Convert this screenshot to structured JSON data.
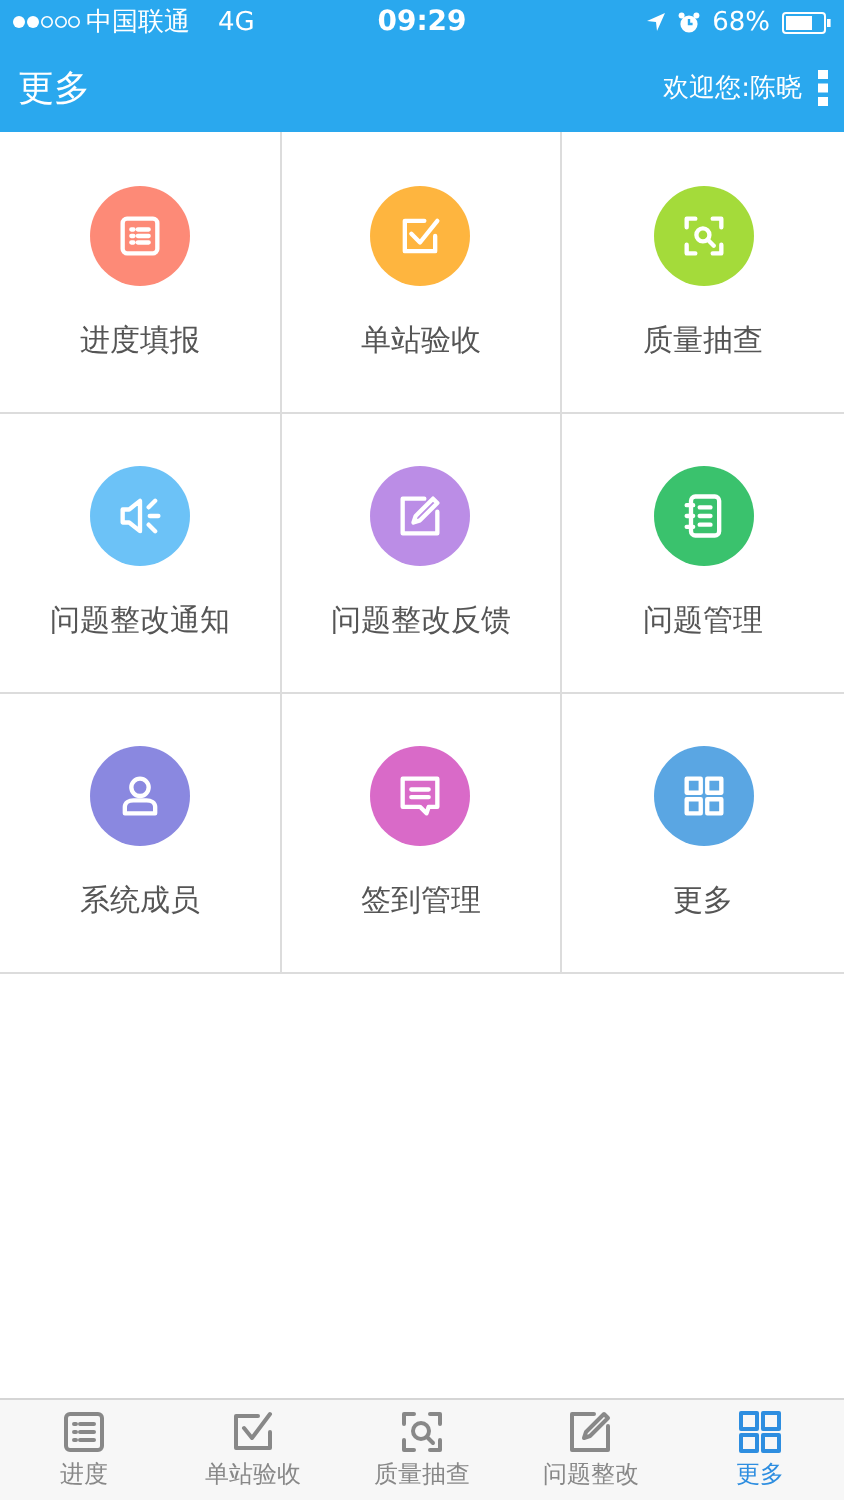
{
  "status_bar": {
    "carrier": "中国联通",
    "network": "4G",
    "time": "09:29",
    "battery": "68%"
  },
  "header": {
    "title": "更多",
    "welcome": "欢迎您:陈晓"
  },
  "grid": [
    {
      "label": "进度填报",
      "kind": "list",
      "color": "#fd8a77"
    },
    {
      "label": "单站验收",
      "kind": "check",
      "color": "#feb53f"
    },
    {
      "label": "质量抽查",
      "kind": "scan",
      "color": "#a4db3a"
    },
    {
      "label": "问题整改通知",
      "kind": "speaker",
      "color": "#6cc2f7"
    },
    {
      "label": "问题整改反馈",
      "kind": "edit",
      "color": "#bb8de6"
    },
    {
      "label": "问题管理",
      "kind": "notebook",
      "color": "#3ac26d"
    },
    {
      "label": "系统成员",
      "kind": "person",
      "color": "#8a88e0"
    },
    {
      "label": "签到管理",
      "kind": "chat",
      "color": "#d96ac8"
    },
    {
      "label": "更多",
      "kind": "grid",
      "color": "#5aa6e3"
    }
  ],
  "tabs": [
    {
      "label": "进度",
      "kind": "list",
      "selected": false
    },
    {
      "label": "单站验收",
      "kind": "check",
      "selected": false
    },
    {
      "label": "质量抽查",
      "kind": "scan",
      "selected": false
    },
    {
      "label": "问题整改",
      "kind": "edit",
      "selected": false
    },
    {
      "label": "更多",
      "kind": "grid",
      "selected": true
    }
  ]
}
